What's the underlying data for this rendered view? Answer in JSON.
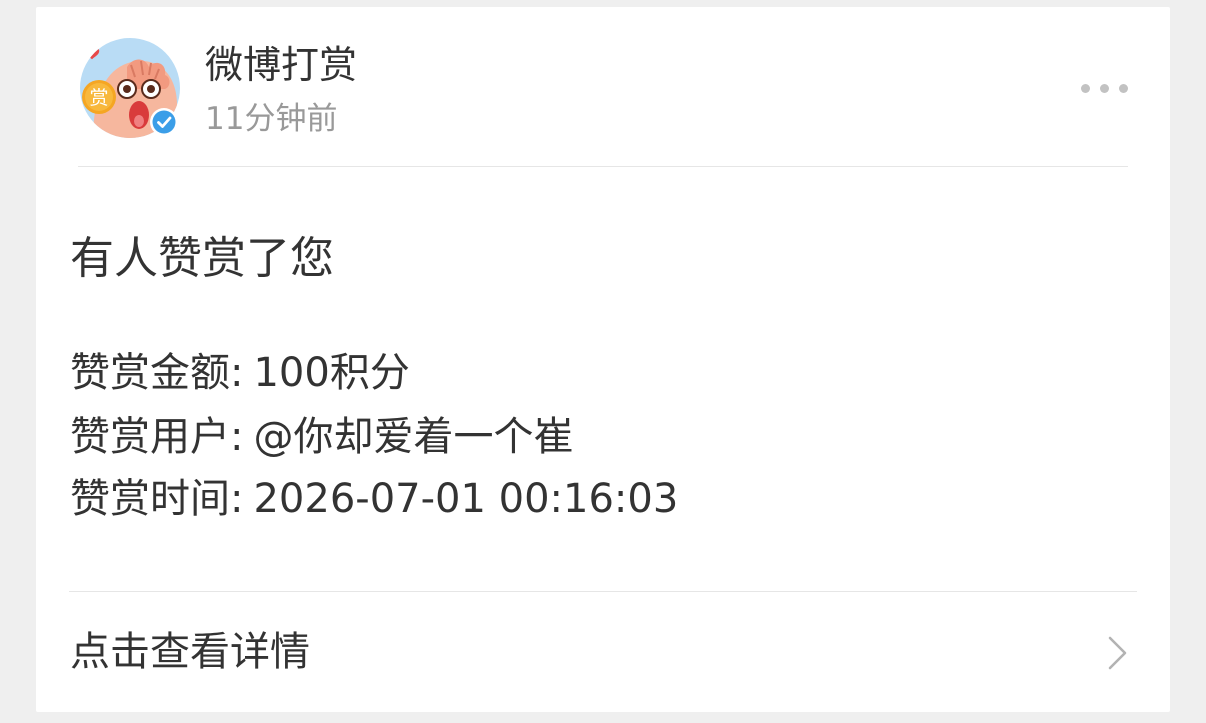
{
  "post": {
    "sender_name": "微博打赏",
    "time_ago": "11分钟前",
    "avatar_badge": "赏",
    "avatar_icon": "tip-mascot-avatar",
    "verified_icon": "verified-check-icon",
    "more_icon": "more-dots-icon"
  },
  "message": {
    "headline": "有人赞赏了您",
    "details": [
      {
        "label": "赞赏金额",
        "value": "100积分"
      },
      {
        "label": "赞赏用户",
        "value": "@你却爱着一个崔"
      },
      {
        "label": "赞赏时间",
        "value": "2026-07-01 00:16:03"
      }
    ],
    "separator": ":"
  },
  "action": {
    "label": "点击查看详情",
    "icon": "chevron-right-icon"
  },
  "colors": {
    "background": "#efefef",
    "card": "#ffffff",
    "primary_text": "#333333",
    "secondary_text": "#999999",
    "verified_badge": "#3b9ee8",
    "divider": "#e6e6e6"
  }
}
